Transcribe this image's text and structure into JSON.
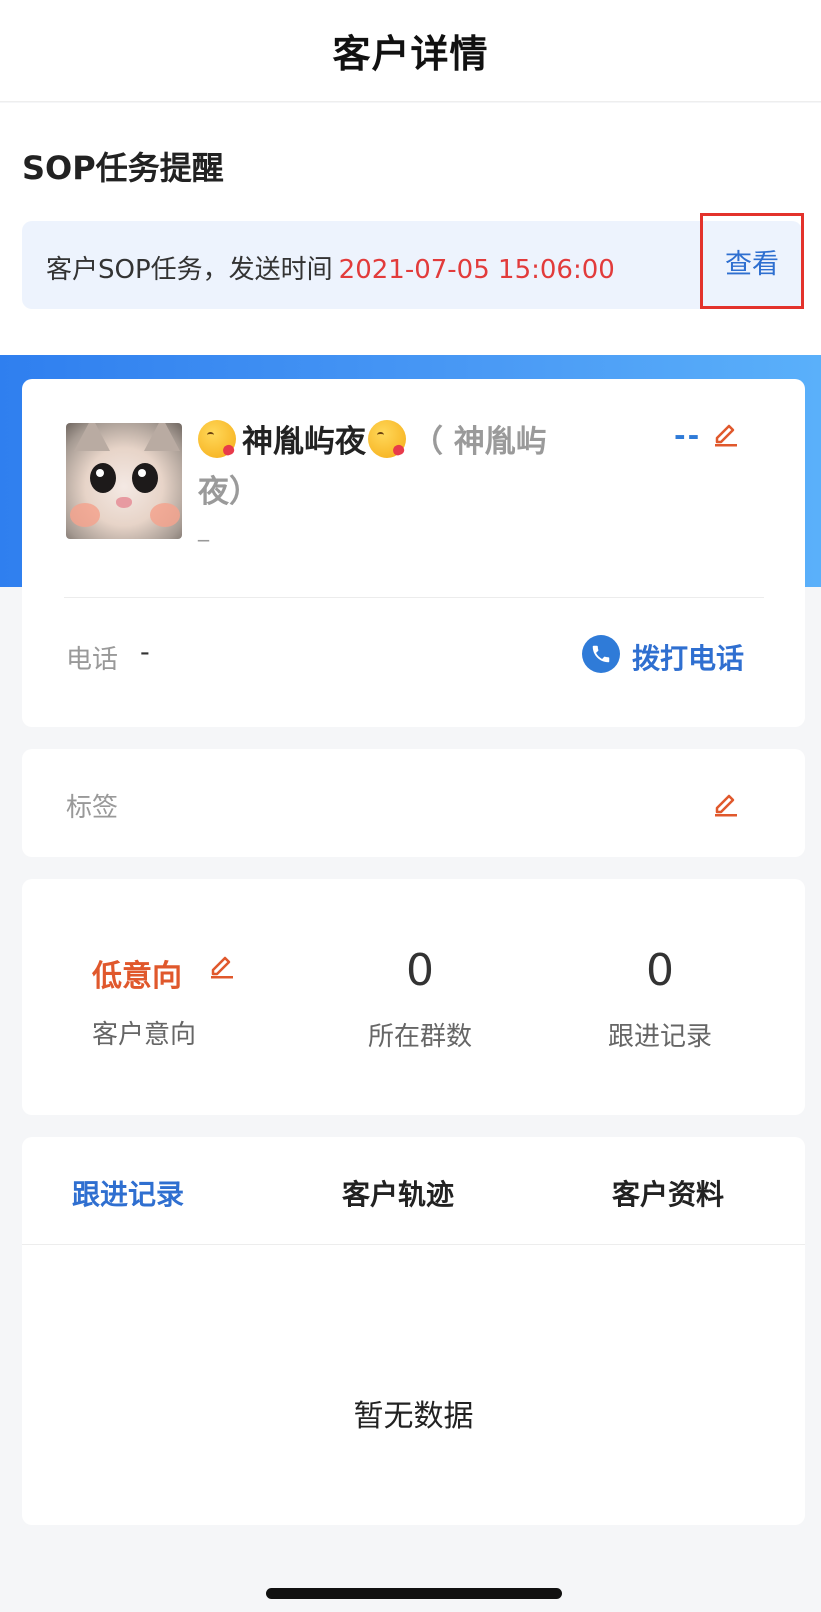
{
  "nav": {
    "title": "客户详情"
  },
  "sop": {
    "heading": "SOP任务提醒",
    "message": "客户SOP任务，发送时间",
    "time": "2021-07-05 15:06:00",
    "view_label": "查看"
  },
  "profile": {
    "name": "神胤屿夜",
    "nickname": "（ 神胤屿夜）",
    "under_name": "_",
    "status": "--",
    "phone_label": "电话",
    "phone_value": "-",
    "call_label": "拨打电话"
  },
  "tags": {
    "label": "标签"
  },
  "stats": {
    "intent_value": "低意向",
    "intent_label": "客户意向",
    "groups_count": "0",
    "groups_label": "所在群数",
    "followups_count": "0",
    "followups_label": "跟进记录"
  },
  "tabs": {
    "items": [
      {
        "label": "跟进记录"
      },
      {
        "label": "客户轨迹"
      },
      {
        "label": "客户资料"
      }
    ],
    "empty_text": "暂无数据"
  },
  "colors": {
    "accent_blue": "#2f6fd0",
    "accent_red": "#e23b3b",
    "edit_orange": "#e0582c",
    "highlight_box": "#e3322b"
  },
  "icons": {
    "edit": "pencil-icon",
    "phone": "phone-icon",
    "emoji": "kiss-emoji-icon",
    "avatar": "cat-avatar"
  }
}
